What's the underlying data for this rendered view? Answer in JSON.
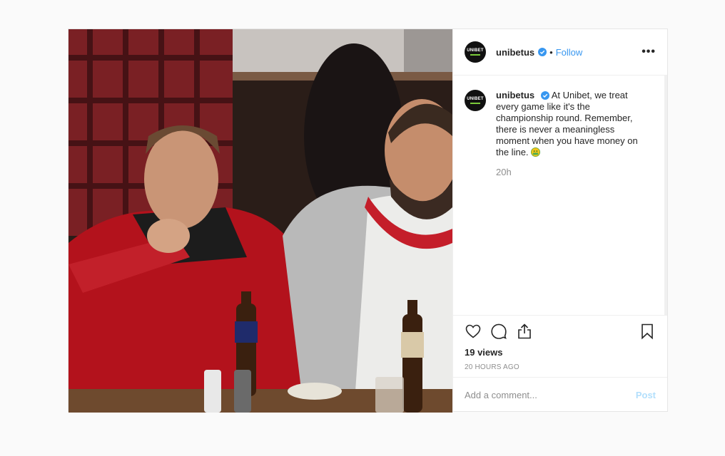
{
  "post": {
    "account": {
      "username": "unibetus",
      "avatar_text": "UNIBET",
      "separator": "•",
      "follow_label": "Follow",
      "more_label": "•••"
    },
    "caption": {
      "username": "unibetus",
      "text": "At Unibet, we treat every game like it's the championship round. Remember, there is never a meaningless moment when you have money on the line.",
      "emoji": "money-mouth-face",
      "relative_time": "20h"
    },
    "actions": {
      "icons": [
        "heart-icon",
        "comment-icon",
        "share-icon",
        "bookmark-icon"
      ]
    },
    "views_label": "19 views",
    "timestamp": "20 HOURS AGO",
    "comment_box": {
      "placeholder": "Add a comment...",
      "post_label": "Post"
    },
    "colors": {
      "link_blue": "#3897f0",
      "post_disabled": "#b2dffc",
      "verified_blue": "#3897f0",
      "muted": "#8e8e8e"
    }
  }
}
